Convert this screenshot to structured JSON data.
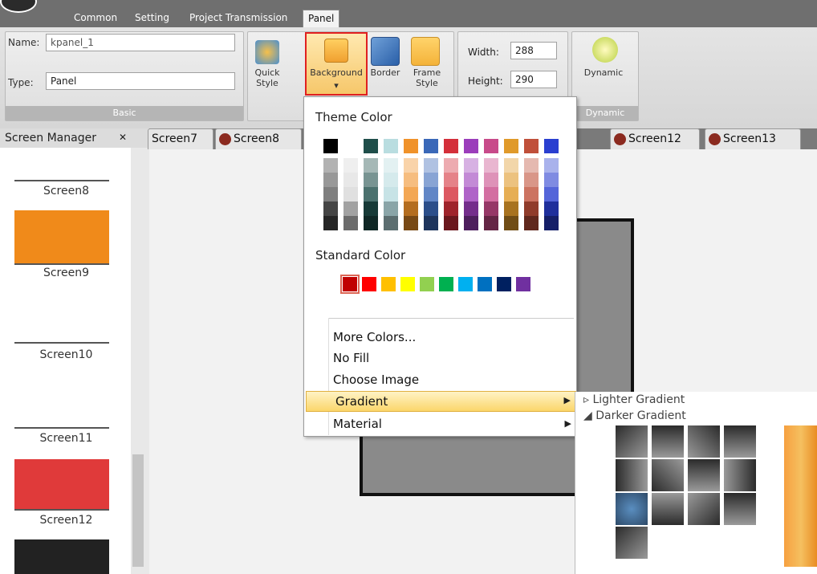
{
  "tabs": [
    "Common",
    "Setting",
    "Project Transmission",
    "Panel"
  ],
  "basic": {
    "name_label": "Name:",
    "name_value": "kpanel_1",
    "type_label": "Type:",
    "type_value": "Panel",
    "group": "Basic"
  },
  "buttons": {
    "quick_style": "Quick Style",
    "background": "Background",
    "border": "Border",
    "frame_style": "Frame Style",
    "dynamic": "Dynamic"
  },
  "size": {
    "width_label": "Width:",
    "width": "288",
    "height_label": "Height:",
    "height": "290"
  },
  "dynamic_group": "Dynamic",
  "screen_manager": {
    "title": "Screen Manager",
    "items": [
      "Screen8",
      "Screen9",
      "Screen10",
      "Screen11",
      "Screen12"
    ]
  },
  "doc_tabs": [
    "Screen7",
    "Screen8",
    "Screen12",
    "Screen13"
  ],
  "menu": {
    "theme": "Theme Color",
    "standard": "Standard Color",
    "items": [
      "More Colors...",
      "No Fill",
      "Choose Image",
      "Gradient",
      "Material"
    ]
  },
  "gradient": {
    "lighter": "Lighter Gradient",
    "darker": "Darker Gradient"
  },
  "colors": {
    "theme_top": [
      "#000000",
      "#ffffff",
      "#1f4e4a",
      "#b9dde0",
      "#f0922a",
      "#3a68b8",
      "#d42f3a",
      "#9b3dbb",
      "#c84a8a",
      "#e09a2a",
      "#c0503a",
      "#2a3fd0"
    ],
    "standard": [
      "#c00000",
      "#ff0000",
      "#ffc000",
      "#ffff00",
      "#92d050",
      "#00b050",
      "#00b0f0",
      "#0070c0",
      "#002060",
      "#7030a0"
    ]
  }
}
